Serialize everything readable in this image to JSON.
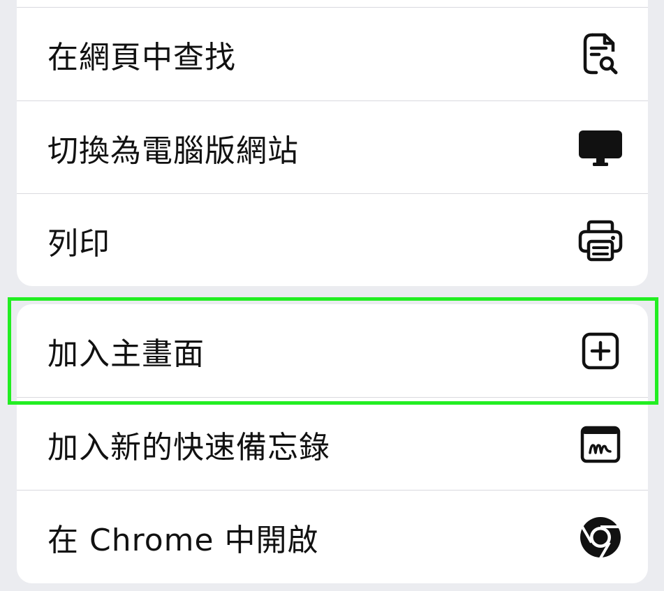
{
  "menu_groups": [
    {
      "items": [
        {
          "label": "在網頁中查找",
          "icon": "find-in-page-icon"
        },
        {
          "label": "切換為電腦版網站",
          "icon": "desktop-icon"
        },
        {
          "label": "列印",
          "icon": "printer-icon"
        }
      ]
    },
    {
      "items": [
        {
          "label": "加入主畫面",
          "icon": "add-square-icon"
        },
        {
          "label": "加入新的快速備忘錄",
          "icon": "quick-note-icon"
        },
        {
          "label": "在 Chrome 中開啟",
          "icon": "chrome-icon"
        }
      ]
    }
  ],
  "highlight": {
    "target": "加入主畫面",
    "color": "#22ee22"
  },
  "colors": {
    "background": "#ebecf0",
    "surface": "#ffffff",
    "text": "#111111",
    "divider": "#d9d9de"
  }
}
